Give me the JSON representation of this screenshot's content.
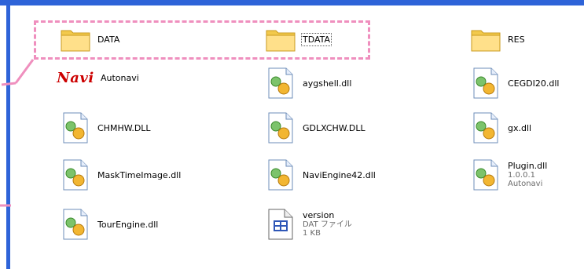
{
  "items": {
    "data": {
      "label": "DATA",
      "icon": "folder-icon"
    },
    "tdata": {
      "label": "TDATA",
      "icon": "folder-icon"
    },
    "res": {
      "label": "RES",
      "icon": "folder-icon"
    },
    "autonavi": {
      "label": "Autonavi",
      "icon": "navi-logo-icon",
      "logo_text": "Navi"
    },
    "aygshell": {
      "label": "aygshell.dll",
      "icon": "dll-icon"
    },
    "cegdi": {
      "label": "CEGDI20.dll",
      "icon": "dll-icon"
    },
    "chmhw": {
      "label": "CHMHW.DLL",
      "icon": "dll-icon"
    },
    "gdlx": {
      "label": "GDLXCHW.DLL",
      "icon": "dll-icon"
    },
    "gx": {
      "label": "gx.dll",
      "icon": "dll-icon"
    },
    "mask": {
      "label": "MaskTimeImage.dll",
      "icon": "dll-icon"
    },
    "naviengine": {
      "label": "NaviEngine42.dll",
      "icon": "dll-icon"
    },
    "plugin": {
      "label": "Plugin.dll",
      "version": "1.0.0.1",
      "company": "Autonavi",
      "icon": "dll-icon"
    },
    "tour": {
      "label": "TourEngine.dll",
      "icon": "dll-icon"
    },
    "version": {
      "label": "version",
      "type": "DAT ファイル",
      "size": "1 KB",
      "icon": "dat-file-icon"
    }
  },
  "colors": {
    "accent_blue": "#2e63d8",
    "highlight_pink": "#ef8fbe",
    "logo_red": "#cc0000"
  }
}
